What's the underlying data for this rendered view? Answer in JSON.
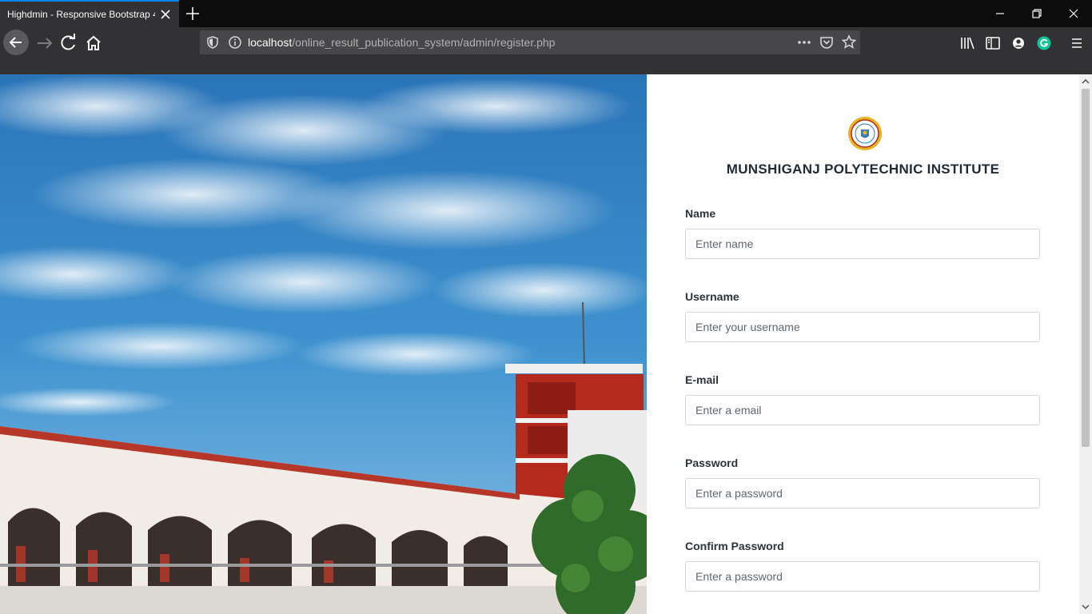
{
  "browser": {
    "tab_title": "Highdmin - Responsive Bootstrap 4",
    "url_host": "localhost",
    "url_path": "/online_result_publication_system/admin/register.php",
    "accent": "#0a84ff"
  },
  "institute": {
    "name": "MUNSHIGANJ POLYTECHNIC INSTITUTE",
    "logo_icon": "institute-seal-icon"
  },
  "form": {
    "fields": [
      {
        "label": "Name",
        "placeholder": "Enter name"
      },
      {
        "label": "Username",
        "placeholder": "Enter your username"
      },
      {
        "label": "E-mail",
        "placeholder": "Enter a email"
      },
      {
        "label": "Password",
        "placeholder": "Enter a password"
      },
      {
        "label": "Confirm Password",
        "placeholder": "Enter a password"
      }
    ]
  },
  "hero": {
    "icon": "campus-building-photo"
  }
}
